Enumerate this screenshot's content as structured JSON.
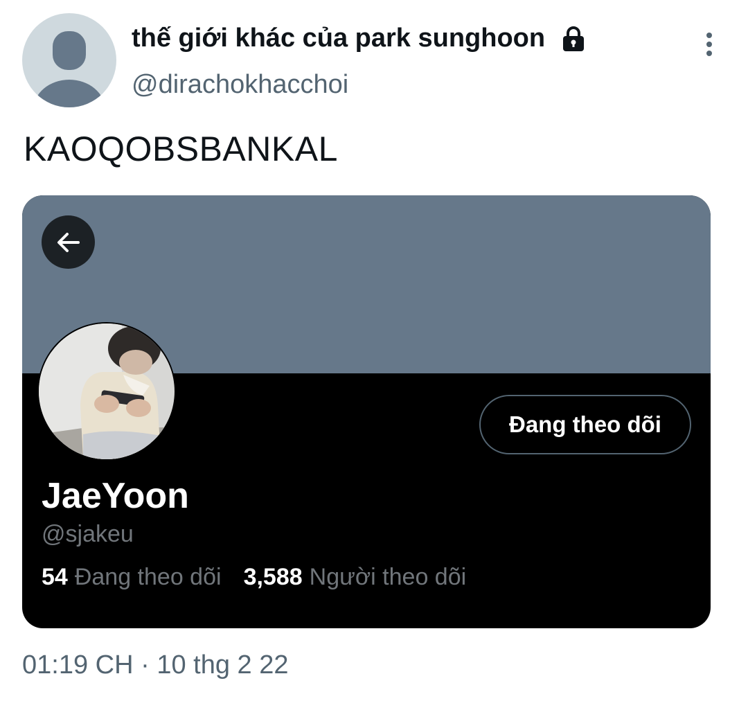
{
  "tweet": {
    "author_name": "thế giới khác của park sunghoon",
    "author_handle": "@dirachokhacchoi",
    "author_protected_icon": "lock-icon",
    "more_icon": "vertical-ellipsis-icon",
    "text": "KAOQOBSBANKAL",
    "timestamp": "01:19 CH",
    "separator": "·",
    "date": "10 thg 2 22"
  },
  "profile_card": {
    "back_icon": "arrow-left-icon",
    "display_name": "JaeYoon",
    "handle": "@sjakeu",
    "follow_button_label": "Đang theo dõi",
    "following_count": "54",
    "following_label": "Đang theo dõi",
    "followers_count": "3,588",
    "followers_label": "Người theo dõi"
  },
  "colors": {
    "banner": "#66788a",
    "card_background": "#000000",
    "secondary_text": "#536471"
  }
}
